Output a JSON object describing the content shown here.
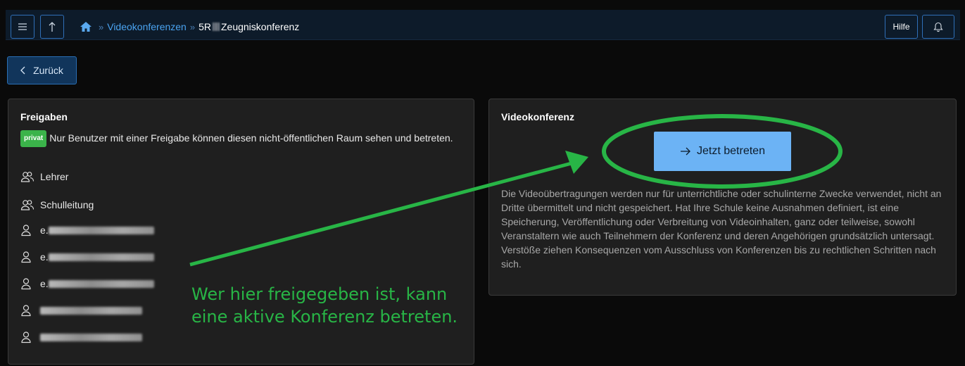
{
  "header": {
    "menu_icon": "hamburger-icon",
    "up_icon": "arrow-up-icon",
    "home_icon": "home-icon",
    "crumb_link": "Videokonferenzen",
    "crumb_sep": "»",
    "crumb_current_prefix": "5R",
    "crumb_current_suffix": "Zeugniskonferenz",
    "help_label": "Hilfe",
    "bell_icon": "bell-icon"
  },
  "back_button": {
    "label": "Zurück",
    "icon": "chevron-left-icon"
  },
  "shares": {
    "title": "Freigaben",
    "badge": "privat",
    "description": "Nur Benutzer mit einer Freigabe können diesen nicht-öffentlichen Raum sehen und betreten.",
    "groups": [
      {
        "label": "Lehrer",
        "icon": "users-icon"
      },
      {
        "label": "Schulleitung",
        "icon": "users-icon"
      }
    ],
    "users": [
      {
        "prefix": "e.",
        "icon": "user-icon"
      },
      {
        "prefix": "e.",
        "icon": "user-icon"
      },
      {
        "prefix": "e.",
        "icon": "user-icon"
      },
      {
        "prefix": "",
        "icon": "user-icon"
      },
      {
        "prefix": "",
        "icon": "user-icon"
      }
    ]
  },
  "conference": {
    "title": "Videokonferenz",
    "join_label": "Jetzt betreten",
    "join_icon": "arrow-right-icon",
    "notice": "Die Videoübertragungen werden nur für unterrichtliche oder schulinterne Zwecke verwendet, nicht an Dritte übermittelt und nicht gespeichert. Hat Ihre Schule keine Ausnahmen definiert, ist eine Speicherung, Veröffentlichung oder Verbreitung von Videoinhalten, ganz oder teilweise, sowohl Veranstaltern wie auch Teilnehmern der Konferenz und deren Angehörigen grundsätzlich untersagt. Verstöße ziehen Konsequenzen vom Ausschluss von Konferenzen bis zu rechtlichen Schritten nach sich."
  },
  "annotation": {
    "line1": "Wer hier freigegeben ist, kann",
    "line2": "eine aktive Konferenz betreten.",
    "color": "#28b546"
  }
}
